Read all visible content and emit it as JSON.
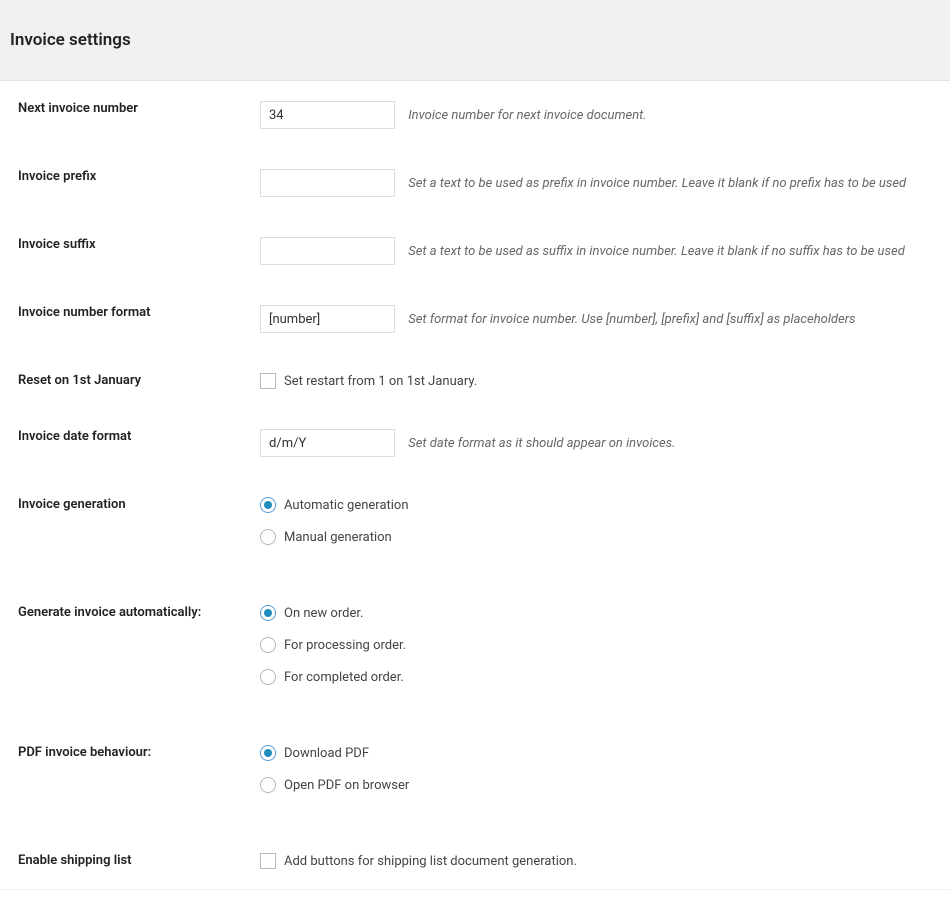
{
  "header": {
    "title": "Invoice settings"
  },
  "fields": {
    "next_invoice_number": {
      "label": "Next invoice number",
      "value": "34",
      "description": "Invoice number for next invoice document."
    },
    "invoice_prefix": {
      "label": "Invoice prefix",
      "value": "",
      "description": "Set a text to be used as prefix in invoice number. Leave it blank if no prefix has to be used"
    },
    "invoice_suffix": {
      "label": "Invoice suffix",
      "value": "",
      "description": "Set a text to be used as suffix in invoice number. Leave it blank if no suffix has to be used"
    },
    "invoice_number_format": {
      "label": "Invoice number format",
      "value": "[number]",
      "description": "Set format for invoice number. Use [number], [prefix] and [suffix] as placeholders"
    },
    "reset_january": {
      "label": "Reset on 1st January",
      "checkbox_label": "Set restart from 1 on 1st January."
    },
    "invoice_date_format": {
      "label": "Invoice date format",
      "value": "d/m/Y",
      "description": "Set date format as it should appear on invoices."
    },
    "invoice_generation": {
      "label": "Invoice generation",
      "options": {
        "automatic": "Automatic generation",
        "manual": "Manual generation"
      }
    },
    "generate_auto": {
      "label": "Generate invoice automatically:",
      "options": {
        "new_order": "On new order.",
        "processing": "For processing order.",
        "completed": "For completed order."
      }
    },
    "pdf_behaviour": {
      "label": "PDF invoice behaviour:",
      "options": {
        "download": "Download PDF",
        "open": "Open PDF on browser"
      }
    },
    "shipping_list": {
      "label": "Enable shipping list",
      "checkbox_label": "Add buttons for shipping list document generation."
    }
  }
}
